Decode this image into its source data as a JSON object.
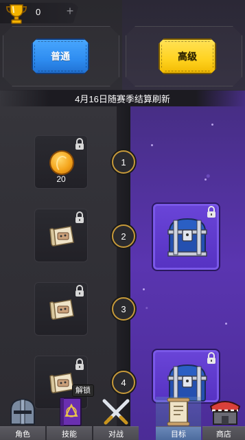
{
  "top_bar": {
    "trophy_count": "0",
    "add_icon": "plus-icon"
  },
  "tiers": {
    "normal_label": "普通",
    "premium_label": "高级"
  },
  "season_banner": "4月16日随赛季结算刷新",
  "levels": [
    {
      "number": "1",
      "free_reward": {
        "type": "coin",
        "qty": "20"
      },
      "premium_reward": null
    },
    {
      "number": "2",
      "free_reward": {
        "type": "scroll-ticket",
        "qty": ""
      },
      "premium_reward": {
        "type": "blue-chest"
      }
    },
    {
      "number": "3",
      "free_reward": {
        "type": "scroll-ticket",
        "qty": ""
      },
      "premium_reward": null
    },
    {
      "number": "4",
      "free_reward": {
        "type": "scroll-ticket",
        "qty": ""
      },
      "premium_reward": {
        "type": "blue-chest"
      }
    }
  ],
  "unlock_label": "解锁",
  "nav": [
    {
      "label": "角色",
      "icon": "helmet-icon",
      "active": false
    },
    {
      "label": "技能",
      "icon": "spellbook-icon",
      "active": false
    },
    {
      "label": "对战",
      "icon": "crossed-swords-icon",
      "active": false
    },
    {
      "label": "目标",
      "icon": "scroll-icon",
      "active": true
    },
    {
      "label": "商店",
      "icon": "shop-icon",
      "active": false
    }
  ],
  "colors": {
    "normal_blue": "#2e8cf0",
    "premium_yellow": "#ffd21f",
    "premium_purple": "#5a35b0",
    "node_gold": "#c79a3a"
  }
}
